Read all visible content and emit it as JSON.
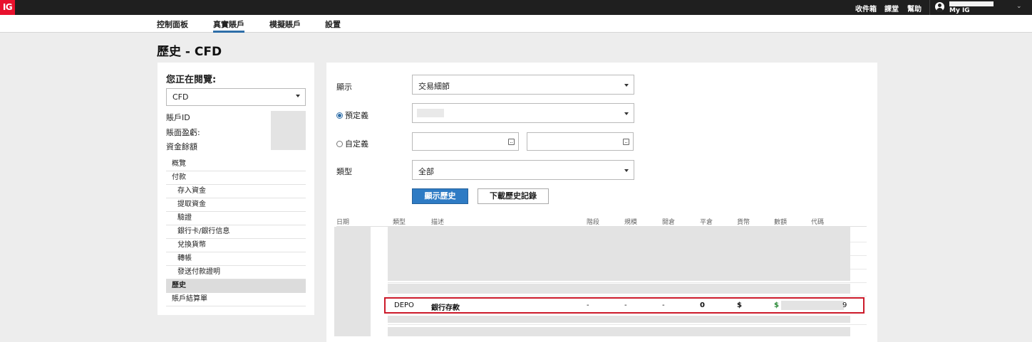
{
  "topbar": {
    "logo": "IG",
    "links": [
      "收件箱",
      "課堂",
      "幫助"
    ],
    "account_label": "My IG",
    "chevron": "⌄"
  },
  "nav": {
    "items": [
      {
        "label": "控制面板"
      },
      {
        "label": "真實賬戶"
      },
      {
        "label": "模擬賬戶"
      },
      {
        "label": "設置"
      }
    ]
  },
  "page_title": "歷史 - CFD",
  "left_panel": {
    "heading": "您正在閱覽:",
    "account_select": "CFD",
    "info_labels": [
      "賬戶ID",
      "賬面盈虧:",
      "資金餘額"
    ],
    "menu": [
      {
        "label": "概覽"
      },
      {
        "label": "付款"
      },
      {
        "label": "存入資金"
      },
      {
        "label": "提取資金"
      },
      {
        "label": "驗證"
      },
      {
        "label": "銀行卡/銀行信息"
      },
      {
        "label": "兌換貨幣"
      },
      {
        "label": "轉帳"
      },
      {
        "label": "發送付款證明"
      },
      {
        "label": "歷史"
      },
      {
        "label": "賬戶結算單"
      }
    ]
  },
  "filters": {
    "show_label": "顯示",
    "show_value": "交易細節",
    "predefined_label": "預定義",
    "custom_label": "自定義",
    "type_label": "類型",
    "type_value": "全部",
    "show_history_button": "顯示歷史",
    "download_button": "下載歷史記錄"
  },
  "table": {
    "headers": [
      "日期",
      "類型",
      "描述",
      "階段",
      "規模",
      "開倉",
      "平倉",
      "貨幣",
      "數額",
      "代碼"
    ],
    "highlight_row": {
      "type": "DEPO",
      "description": "銀行存款",
      "stage": "-",
      "size": "-",
      "open": "-",
      "close": "0",
      "currency": "$",
      "amount_prefix": "$",
      "code_tail": "9"
    }
  },
  "colors": {
    "brand_red": "#e8112d",
    "primary_blue": "#2e7bc4",
    "highlight_border": "#cc1a2a",
    "amount_green": "#2e8b3a"
  }
}
